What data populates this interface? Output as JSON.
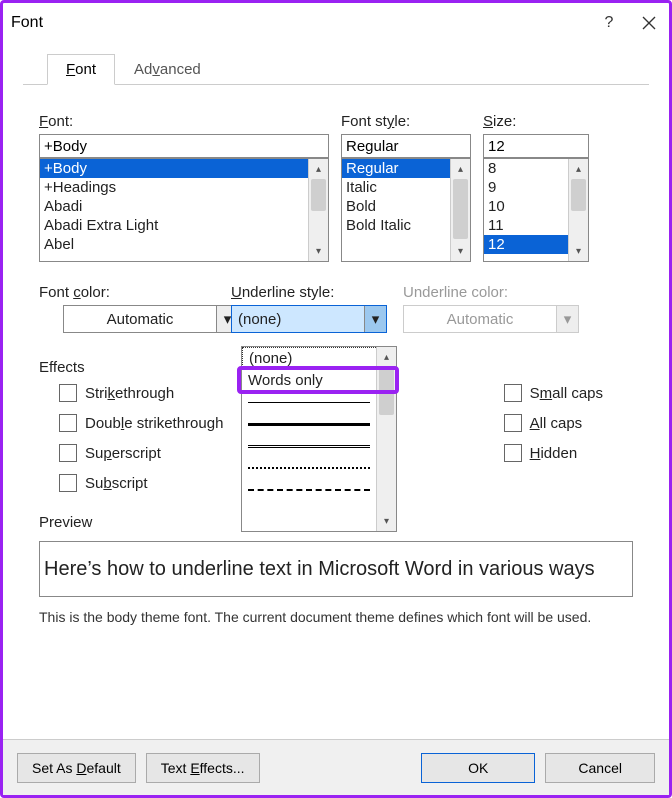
{
  "window": {
    "title": "Font"
  },
  "tabs": {
    "font": "Font",
    "advanced": "Advanced"
  },
  "font": {
    "label": "Font:",
    "value": "+Body",
    "list": [
      "+Body",
      "+Headings",
      "Abadi",
      "Abadi Extra Light",
      "Abel"
    ],
    "selectedIndex": 0
  },
  "style": {
    "label": "Font style:",
    "value": "Regular",
    "list": [
      "Regular",
      "Italic",
      "Bold",
      "Bold Italic"
    ],
    "selectedIndex": 0
  },
  "size": {
    "label": "Size:",
    "value": "12",
    "list": [
      "8",
      "9",
      "10",
      "11",
      "12"
    ],
    "selectedIndex": 4
  },
  "fontcolor": {
    "label": "Font color:",
    "value": "Automatic"
  },
  "underlinestyle": {
    "label": "Underline style:",
    "value": "(none)",
    "options": {
      "none": "(none)",
      "words": "Words only"
    }
  },
  "underlinecolor": {
    "label": "Underline color:",
    "value": "Automatic"
  },
  "effects": {
    "title": "Effects",
    "strike": "Strikethrough",
    "dblstrike": "Double strikethrough",
    "super": "Superscript",
    "sub": "Subscript",
    "smallcaps": "Small caps",
    "allcaps": "All caps",
    "hidden": "Hidden"
  },
  "preview": {
    "title": "Preview",
    "text": "Here’s how to underline text in Microsoft Word in various ways",
    "note": "This is the body theme font. The current document theme defines which font will be used."
  },
  "footer": {
    "setdefault": "Set As Default",
    "texteffects": "Text Effects...",
    "ok": "OK",
    "cancel": "Cancel"
  }
}
